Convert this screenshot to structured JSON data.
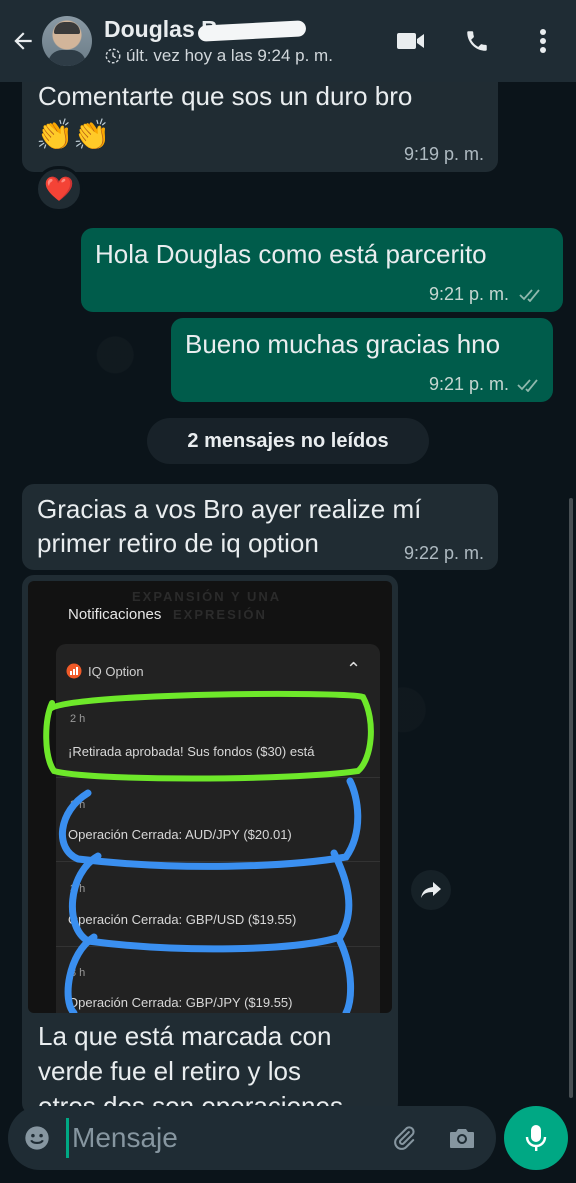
{
  "header": {
    "contact_name": "Douglas Barrera",
    "last_seen": "últ. vez hoy a las 9:24 p. m.",
    "icons": [
      "back-arrow-icon",
      "video-call-icon",
      "phone-icon",
      "more-options-icon"
    ]
  },
  "messages": [
    {
      "dir": "in",
      "text": "Comentarte que sos un duro bro",
      "emojis": "👏👏",
      "time": "9:19 p. m.",
      "reaction": "❤️"
    },
    {
      "dir": "out",
      "text": "Hola Douglas como está parcerito",
      "time": "9:21 p. m.",
      "status": "read"
    },
    {
      "dir": "out",
      "text": "Bueno muchas gracias hno",
      "time": "9:21 p. m.",
      "status": "read"
    },
    {
      "dir": "in",
      "text_line1": "Gracias a vos Bro ayer realize mí",
      "text_line2": "primer retiro de iq option",
      "time": "9:22 p. m."
    }
  ],
  "unread_banner": "2 mensajes no leídos",
  "image_message": {
    "screenshot": {
      "watermark_line1": "EXPANSIÓN Y UNA",
      "watermark_line2": "EXPRESIÓN",
      "title": "Notificaciones",
      "app_name": "IQ Option",
      "items": [
        {
          "ago": "2 h",
          "text": "¡Retirada aprobada! Sus fondos ($30) está",
          "highlight": "green"
        },
        {
          "ago": "2 h",
          "text": "Operación Cerrada: AUD/JPY ($20.01)",
          "highlight": "blue"
        },
        {
          "ago": "3 h",
          "text": "Operación Cerrada: GBP/USD ($19.55)",
          "highlight": "blue"
        },
        {
          "ago": "3 h",
          "text": "Operación Cerrada: GBP/JPY ($19.55)",
          "highlight": "blue"
        }
      ]
    },
    "caption_line1": "La que está marcada con",
    "caption_line2": "verde fue el retiro y los",
    "caption_line3": "otros dos son operaciones"
  },
  "input": {
    "placeholder": "Mensaje"
  },
  "colors": {
    "header": "#1f2c34",
    "incoming": "#202c33",
    "outgoing": "#005c4b",
    "accent": "#00a884",
    "green_mark": "#6ee82a",
    "blue_mark": "#3a8ff0"
  }
}
